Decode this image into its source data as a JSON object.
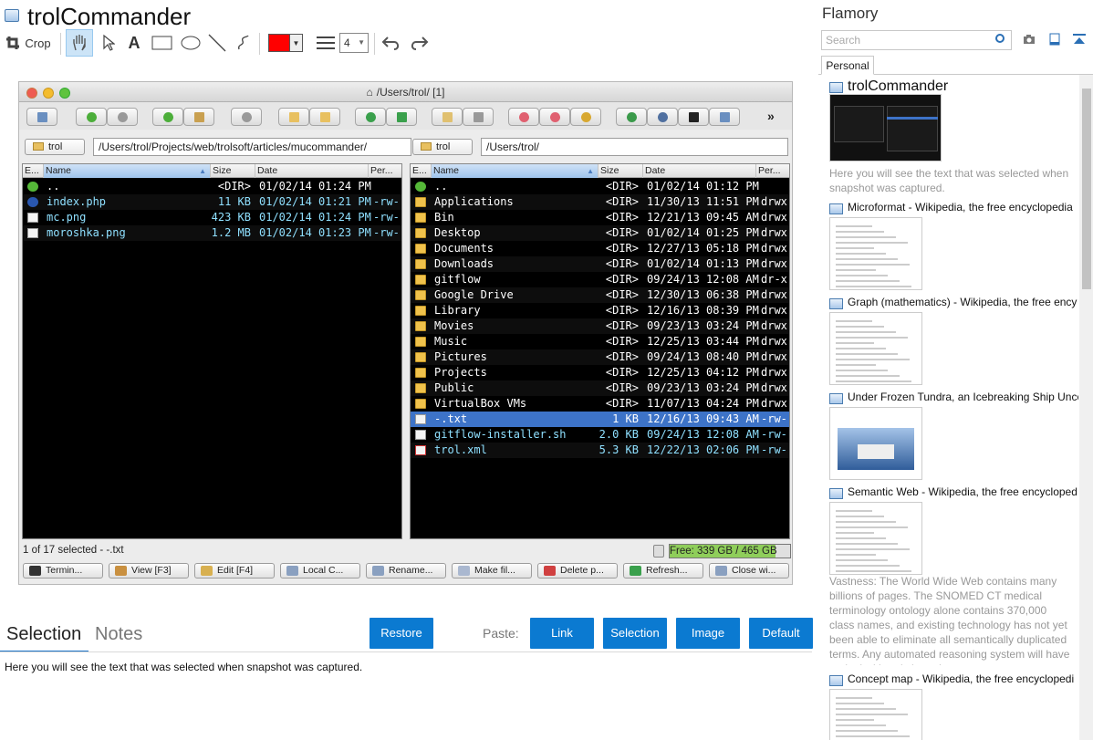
{
  "title": "trolCommander",
  "toolbar": {
    "crop_label": "Crop",
    "line_width": "4",
    "color": "#ff0000"
  },
  "window": {
    "title": "/Users/trol/ [1]"
  },
  "left_panel": {
    "folder_button": "trol",
    "path": "/Users/trol/Projects/web/trolsoft/articles/mucommander/",
    "headers": [
      "E...",
      "Name",
      "Size",
      "Date",
      "Per..."
    ],
    "rows": [
      {
        "name": "..",
        "size": "<DIR>",
        "date": "01/02/14 01:24 PM",
        "perm": "",
        "type": "up"
      },
      {
        "name": "index.php",
        "size": "11 KB",
        "date": "01/02/14 01:21 PM",
        "perm": "-rw-",
        "type": "php"
      },
      {
        "name": "mc.png",
        "size": "423 KB",
        "date": "01/02/14 01:24 PM",
        "perm": "-rw-",
        "type": "doc"
      },
      {
        "name": "moroshka.png",
        "size": "1.2 MB",
        "date": "01/02/14 01:23 PM",
        "perm": "-rw-",
        "type": "doc"
      }
    ]
  },
  "right_panel": {
    "folder_button": "trol",
    "path": "/Users/trol/",
    "headers": [
      "E...",
      "Name",
      "Size",
      "Date",
      "Per..."
    ],
    "rows": [
      {
        "name": "..",
        "size": "<DIR>",
        "date": "01/02/14 01:12 PM",
        "perm": "",
        "type": "up"
      },
      {
        "name": "Applications",
        "size": "<DIR>",
        "date": "11/30/13 11:51 PM",
        "perm": "drwx",
        "type": "folder"
      },
      {
        "name": "Bin",
        "size": "<DIR>",
        "date": "12/21/13 09:45 AM",
        "perm": "drwx",
        "type": "folder"
      },
      {
        "name": "Desktop",
        "size": "<DIR>",
        "date": "01/02/14 01:25 PM",
        "perm": "drwx",
        "type": "folder"
      },
      {
        "name": "Documents",
        "size": "<DIR>",
        "date": "12/27/13 05:18 PM",
        "perm": "drwx",
        "type": "folder"
      },
      {
        "name": "Downloads",
        "size": "<DIR>",
        "date": "01/02/14 01:13 PM",
        "perm": "drwx",
        "type": "folder"
      },
      {
        "name": "gitflow",
        "size": "<DIR>",
        "date": "09/24/13 12:08 AM",
        "perm": "dr-x",
        "type": "folder"
      },
      {
        "name": "Google Drive",
        "size": "<DIR>",
        "date": "12/30/13 06:38 PM",
        "perm": "drwx",
        "type": "folder"
      },
      {
        "name": "Library",
        "size": "<DIR>",
        "date": "12/16/13 08:39 PM",
        "perm": "drwx",
        "type": "folder"
      },
      {
        "name": "Movies",
        "size": "<DIR>",
        "date": "09/23/13 03:24 PM",
        "perm": "drwx",
        "type": "folder"
      },
      {
        "name": "Music",
        "size": "<DIR>",
        "date": "12/25/13 03:44 PM",
        "perm": "drwx",
        "type": "folder"
      },
      {
        "name": "Pictures",
        "size": "<DIR>",
        "date": "09/24/13 08:40 PM",
        "perm": "drwx",
        "type": "folder"
      },
      {
        "name": "Projects",
        "size": "<DIR>",
        "date": "12/25/13 04:12 PM",
        "perm": "drwx",
        "type": "folder"
      },
      {
        "name": "Public",
        "size": "<DIR>",
        "date": "09/23/13 03:24 PM",
        "perm": "drwx",
        "type": "folder"
      },
      {
        "name": "VirtualBox VMs",
        "size": "<DIR>",
        "date": "11/07/13 04:24 PM",
        "perm": "drwx",
        "type": "folder"
      },
      {
        "name": "-.txt",
        "size": "1 KB",
        "date": "12/16/13 09:43 AM",
        "perm": "-rw-",
        "type": "doc",
        "selected": true
      },
      {
        "name": "gitflow-installer.sh",
        "size": "2.0 KB",
        "date": "09/24/13 12:08 AM",
        "perm": "-rw-",
        "type": "doc"
      },
      {
        "name": "trol.xml",
        "size": "5.3 KB",
        "date": "12/22/13 02:06 PM",
        "perm": "-rw-",
        "type": "red"
      }
    ]
  },
  "status": {
    "selection": "1 of 17 selected - -.txt",
    "free": "Free: 339 GB / 465 GB"
  },
  "function_buttons": [
    "Termin...",
    "View [F3]",
    "Edit [F4]",
    "Local C...",
    "Rename...",
    "Make fil...",
    "Delete p...",
    "Refresh...",
    "Close wi..."
  ],
  "bottom": {
    "tab_selection": "Selection",
    "tab_notes": "Notes",
    "restore": "Restore",
    "paste_label": "Paste:",
    "paste_buttons": [
      "Link",
      "Selection",
      "Image",
      "Default"
    ],
    "selection_text": "Here you will see the text that was selected when snapshot was captured."
  },
  "sidebar": {
    "title": "Flamory",
    "search_placeholder": "Search",
    "tab": "Personal",
    "snapshots": [
      {
        "title": "trolCommander",
        "text": "Here you will see the text that was selected when snapshot was captured."
      },
      {
        "title": "Microformat - Wikipedia, the free encyclopedia",
        "text": ""
      },
      {
        "title": "Graph (mathematics) - Wikipedia, the free ency",
        "text": ""
      },
      {
        "title": "Under Frozen Tundra, an Icebreaking Ship Unco",
        "text": ""
      },
      {
        "title": "Semantic Web - Wikipedia, the free encycloped",
        "text": "Vastness: The World Wide Web contains many billions of pages. The SNOMED CT medical terminology ontology alone contains 370,000 class names, and existing technology has not yet been able to eliminate all semantically duplicated terms. Any automated reasoning system will have to deal with truly huge inputs."
      },
      {
        "title": "Concept map - Wikipedia, the free encyclopedi",
        "text": ""
      }
    ]
  }
}
